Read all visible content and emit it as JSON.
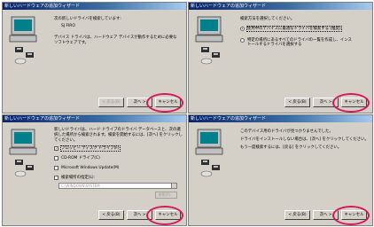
{
  "windows": [
    {
      "title": "新しいハードウェアの追加ウィザード",
      "lines": [
        "次の新しいドライバを検索しています:",
        "SJ FIRO",
        "デバイス ドライバは、ハードウェア デバイスが動作するために必要な\nソフトウェアです。"
      ],
      "buttons": [
        "< 戻る(B)",
        "次へ >",
        "キャンセル"
      ],
      "disabled": [
        true,
        false,
        false
      ]
    },
    {
      "title": "新しいハードウェアの追加ウィザード",
      "lines": [
        "検索方法を選択してください。"
      ],
      "options": [
        {
          "label": "使用中のデバイスに最適なドライバを検索する (推奨)",
          "selected": true
        },
        {
          "label": "特定の場所にあるすべてのドライバの一覧を作成し、インス\nトールするドライバを選択する",
          "selected": false
        }
      ],
      "buttons": [
        "< 戻る(B)",
        "次へ >",
        "キャンセル"
      ],
      "disabled": [
        false,
        false,
        false
      ]
    },
    {
      "title": "新しいハードウェアの追加ウィザード",
      "lines": [
        "新しいドライバは、ハード ドライブのドライバ データベースと、次の選\n択した場所から検索されます。検索を開始するには、[次へ] をクリックし\nてください。"
      ],
      "checks": [
        {
          "label": "フロッピー ディスク ドライブ(F)",
          "checked": true
        },
        {
          "label": "CD-ROM ドライブ(C)",
          "checked": false
        },
        {
          "label": "Microsoft Windows Update(M)",
          "checked": false
        },
        {
          "label": "検索場所の指定(L):",
          "checked": false
        }
      ],
      "path": "C:\\WINDOWS\\SYSTEM",
      "browse": "参照(R)...",
      "buttons": [
        "< 戻る(B)",
        "次へ >",
        "キャンセル"
      ],
      "disabled": [
        false,
        false,
        false
      ]
    },
    {
      "title": "新しいハードウェアの追加ウィザード",
      "lines": [
        "このデバイス用のドライバが見つかりませんでした。",
        "ドライバをインストールしない場合は、[次へ] をクリックしてください。",
        "もう一度検索するには、[戻る] をクリックしてください。"
      ],
      "buttons": [
        "< 戻る(B)",
        "次へ >",
        "キャンセル"
      ],
      "disabled": [
        false,
        false,
        false
      ]
    }
  ]
}
